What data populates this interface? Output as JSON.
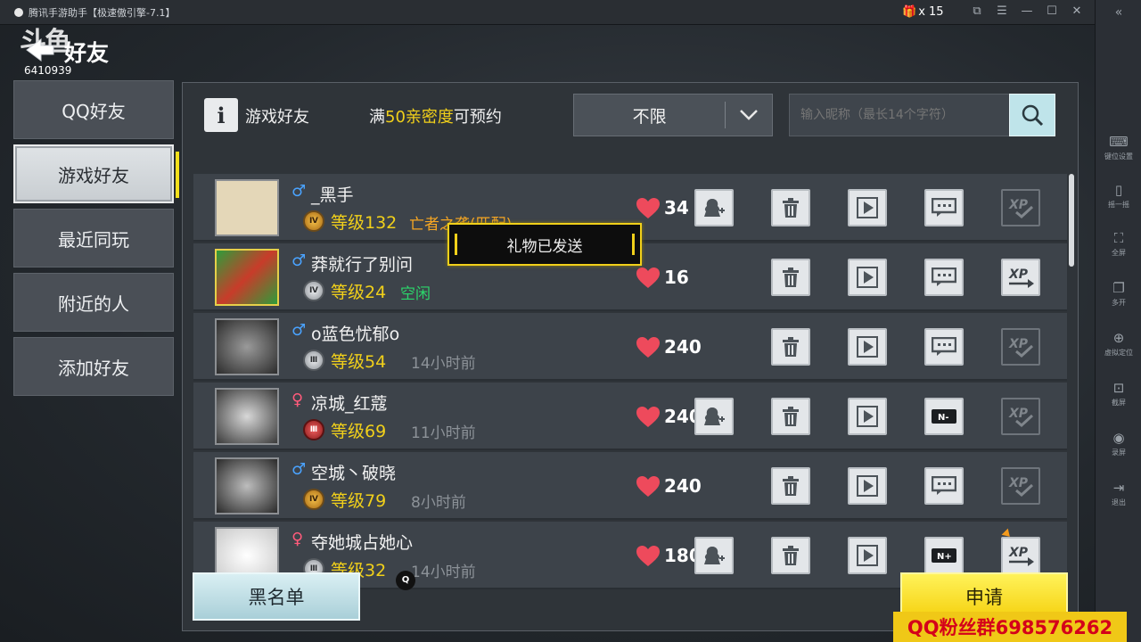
{
  "window": {
    "title": "腾讯手游助手【极速傲引擎-7.1】",
    "gift_count": "x 15"
  },
  "header": {
    "title": "好友",
    "watermark": "斗鱼",
    "room_id": "6410939"
  },
  "left_tabs": [
    {
      "label": "QQ好友",
      "active": false
    },
    {
      "label": "游戏好友",
      "active": true
    },
    {
      "label": "最近同玩",
      "active": false
    },
    {
      "label": "附近的人",
      "active": false
    },
    {
      "label": "添加好友",
      "active": false
    }
  ],
  "panel": {
    "title": "游戏好友",
    "intimacy_prefix": "满",
    "intimacy_value": "50亲密度",
    "intimacy_suffix": "可预约",
    "filter_value": "不限",
    "search_placeholder": "输入昵称（最长14个字符）"
  },
  "friends": [
    {
      "gender": "♂",
      "name": "_黑手",
      "rank": "Ⅳ",
      "level": "等级132",
      "status": "亡者之袭(匹配)",
      "status_color": "orange",
      "hearts": "34"
    },
    {
      "gender": "♂",
      "name": "莽就行了别问",
      "rank": "Ⅳ",
      "level": "等级24",
      "status": "空闲",
      "status_color": "green",
      "hearts": "16"
    },
    {
      "gender": "♂",
      "name": "o蓝色忧郁o",
      "rank": "Ⅲ",
      "level": "等级54",
      "status": "14小时前",
      "status_color": "gray",
      "hearts": "240"
    },
    {
      "gender": "♀",
      "name": "凉城_红蔻",
      "rank": "Ⅲ",
      "level": "等级69",
      "status": "11小时前",
      "status_color": "gray",
      "hearts": "240"
    },
    {
      "gender": "♂",
      "name": "空城丶破晓",
      "rank": "Ⅳ",
      "level": "等级79",
      "status": "8小时前",
      "status_color": "gray",
      "hearts": "240"
    },
    {
      "gender": "♀",
      "name": "夺她城占她心",
      "rank": "Ⅲ",
      "level": "等级32",
      "status": "14小时前",
      "status_color": "gray",
      "hearts": "180"
    }
  ],
  "toast": "礼物已发送",
  "buttons": {
    "blacklist": "黑名单",
    "apply": "申请"
  },
  "q_badge": "Q",
  "fan_banner": "QQ粉丝群698576262",
  "rightbar": [
    {
      "icon": "keyboard-icon",
      "label": "键位设置"
    },
    {
      "icon": "shake-icon",
      "label": "摇一摇"
    },
    {
      "icon": "fullscreen-icon",
      "label": "全屏"
    },
    {
      "icon": "multi-open-icon",
      "label": "多开"
    },
    {
      "icon": "location-icon",
      "label": "虚拟定位"
    },
    {
      "icon": "screenshot-icon",
      "label": "截屏"
    },
    {
      "icon": "record-icon",
      "label": "录屏"
    },
    {
      "icon": "exit-icon",
      "label": "退出"
    }
  ],
  "colors": {
    "accent_yellow": "#f1d01a",
    "male": "#4aa3ff",
    "female": "#ff5b7b",
    "online_green": "#2bd66b"
  }
}
